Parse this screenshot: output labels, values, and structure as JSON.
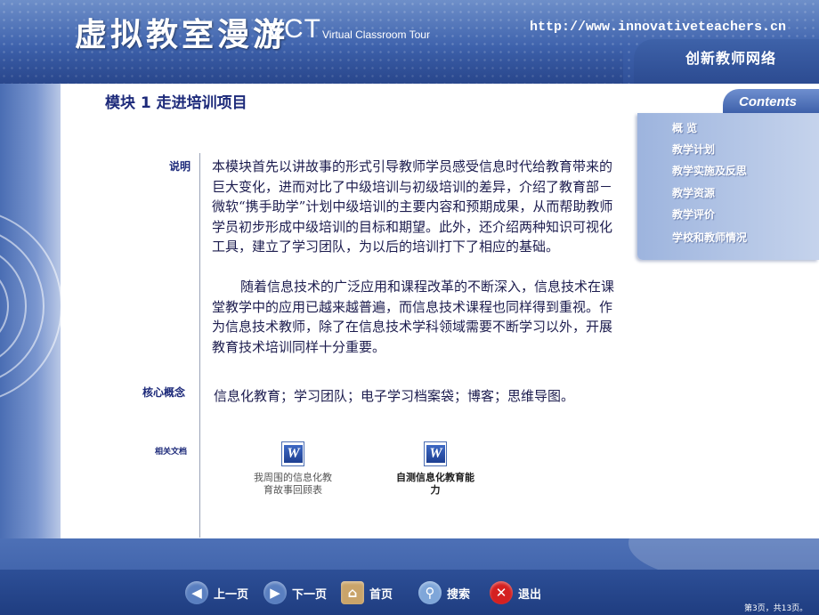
{
  "header": {
    "title": "虚拟教室漫游",
    "vct": "VCT",
    "vct_sub": "Virtual Classroom Tour",
    "url": "http://www.innovativeteachers.cn",
    "network": "创新教师网络"
  },
  "module": {
    "title": "模块 1  走进培训项目"
  },
  "contents": {
    "heading": "Contents",
    "items": [
      "概 览",
      "教学计划",
      "教学实施及反思",
      "教学资源",
      "教学评价",
      "学校和教师情况"
    ]
  },
  "section_labels": {
    "description": "说明",
    "key_concepts": "核心概念",
    "related_docs": "相关文档"
  },
  "description": {
    "paragraph1": "本模块首先以讲故事的形式引导教师学员感受信息时代给教育带来的巨大变化，进而对比了中级培训与初级培训的差异，介绍了教育部－微软“携手助学”计划中级培训的主要内容和预期成果，从而帮助教师学员初步形成中级培训的目标和期望。此外，还介绍两种知识可视化工具，建立了学习团队，为以后的培训打下了相应的基础。",
    "paragraph2": "随着信息技术的广泛应用和课程改革的不断深入，信息技术在课堂教学中的应用已越来越普遍，而信息技术课程也同样得到重视。作为信息技术教师，除了在信息技术学科领域需要不断学习以外，开展教育技术培训同样十分重要。"
  },
  "key_concepts": "信息化教育；学习团队；电子学习档案袋；博客；思维导图。",
  "documents": [
    {
      "caption": "我周围的信息化教育故事回顾表",
      "icon": "word-document-icon"
    },
    {
      "caption": "自测信息化教育能力",
      "icon": "word-document-icon"
    }
  ],
  "nav": {
    "prev": "上一页",
    "next": "下一页",
    "home": "首页",
    "search": "搜索",
    "exit": "退出"
  },
  "page_counter": "第3页，共13页。",
  "colors": {
    "header_blue": "#3f63ad",
    "text_navy": "#1c1c4e",
    "exit_red": "#d42020"
  }
}
